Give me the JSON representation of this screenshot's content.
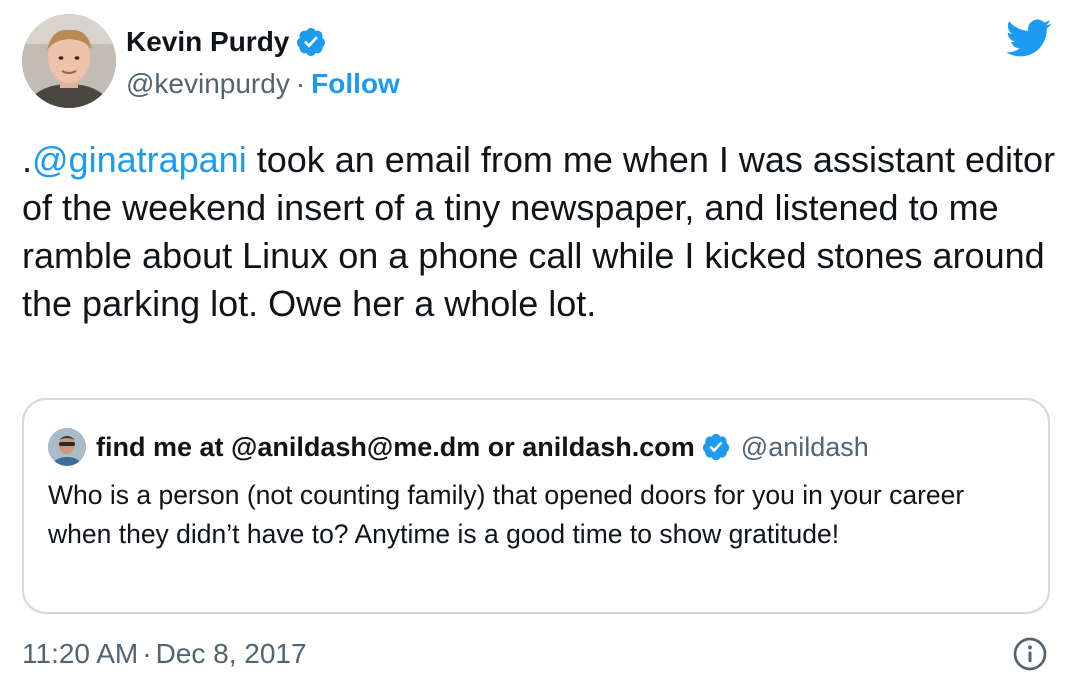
{
  "author": {
    "display_name": "Kevin Purdy",
    "handle": "@kevinpurdy",
    "separator": "·",
    "follow_label": "Follow"
  },
  "tweet": {
    "lead": ".",
    "mention": "@ginatrapani",
    "text": " took an email from me when I was assistant editor of the weekend insert of a tiny newspaper, and listened to me ramble about Linux on a phone call while I kicked stones around the parking lot. Owe her a whole lot."
  },
  "quoted_tweet": {
    "display_name": "find me at @anildash@me.dm or anildash.com",
    "handle": "@anildash",
    "text": "Who is a person (not counting family) that opened doors for you in your career when they didn’t have to? Anytime is a good time to show gratitude!"
  },
  "meta": {
    "time": "11:20 AM",
    "separator": "·",
    "date": "Dec 8, 2017"
  },
  "icons": {
    "brand": "twitter-bird-icon",
    "verified": "verified-badge-icon",
    "info": "info-icon"
  },
  "colors": {
    "accent": "#1d9bf0",
    "text": "#0f1419",
    "secondary": "#536471",
    "border": "#cfd9de"
  }
}
